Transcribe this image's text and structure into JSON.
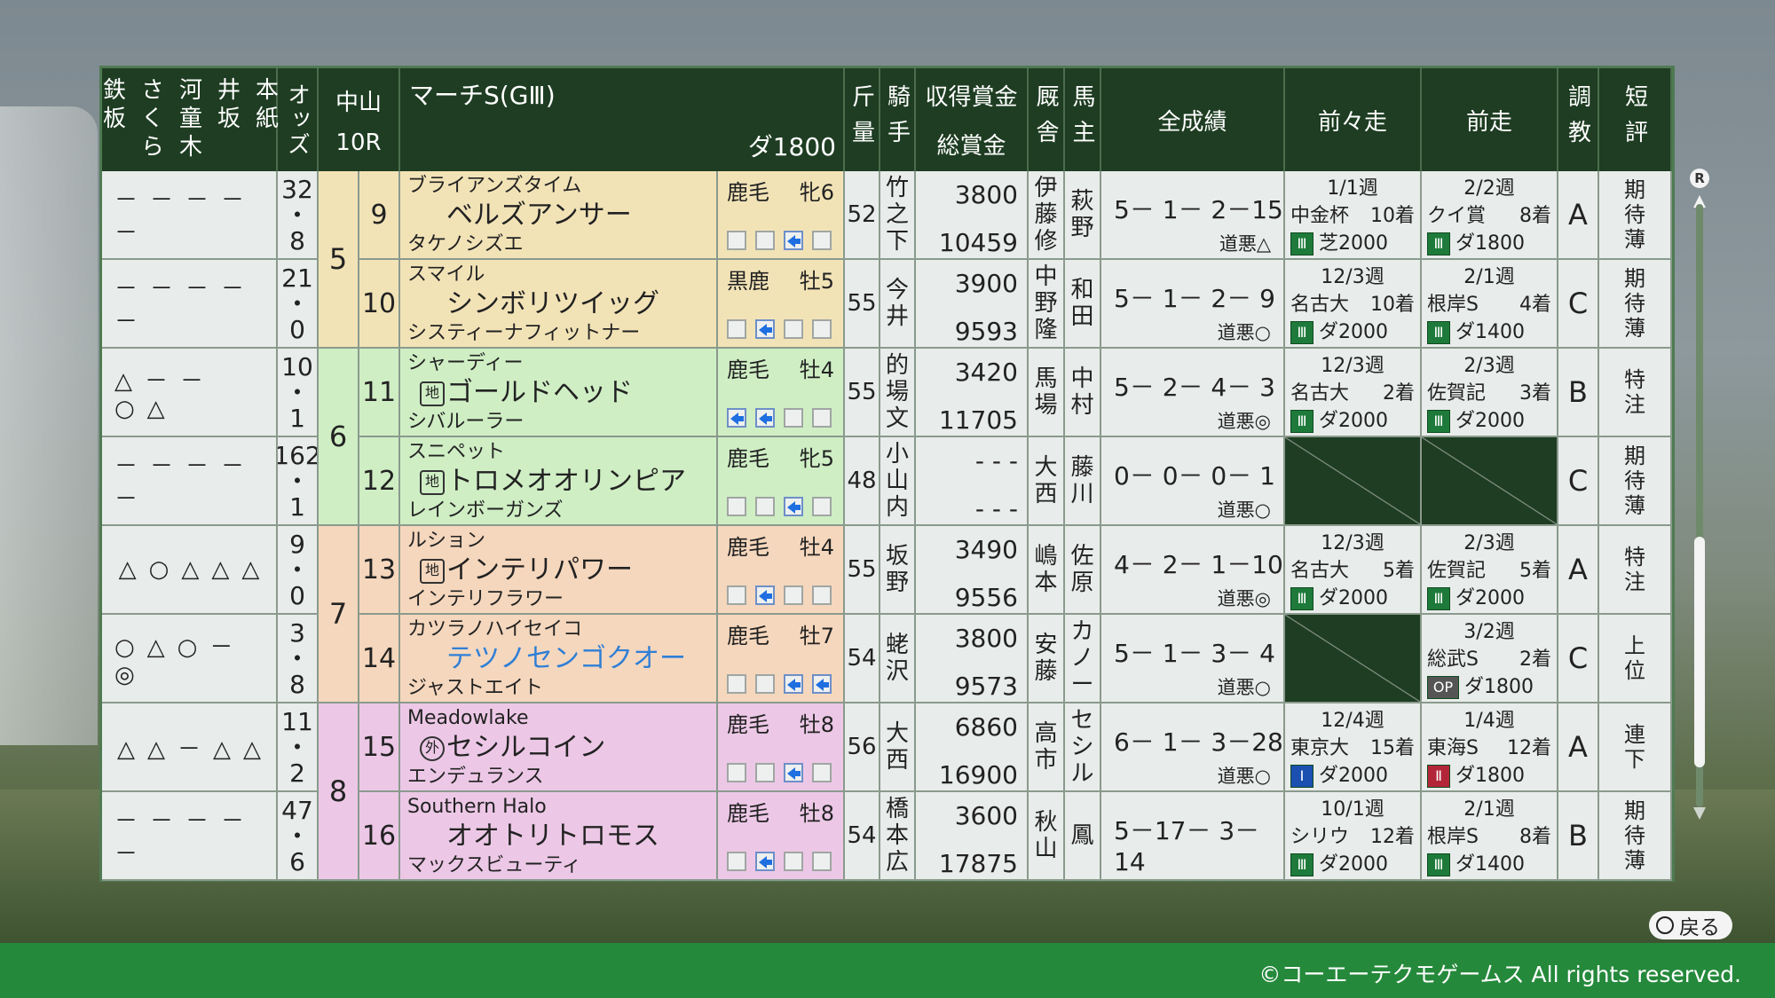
{
  "race": {
    "course": "中山",
    "race_no": "10R",
    "name": "マーチS(GⅢ)",
    "distance": "ダ1800"
  },
  "headers": {
    "marks": [
      "鉄板",
      "さくら",
      "河童木",
      "井坂",
      "本紙"
    ],
    "odds": "オッズ",
    "weight": "斤量",
    "jockey": "騎手",
    "prize": "収得賞金",
    "total_prize": "総賞金",
    "stable": "厩舎",
    "owner": "馬主",
    "record": "全成績",
    "prev2": "前々走",
    "prev1": "前走",
    "training": "調教",
    "short_eval": "短評"
  },
  "frames": [
    {
      "no": "5",
      "color": "#f2e3b7"
    },
    {
      "no": "6",
      "color": "#cfeec4"
    },
    {
      "no": "7",
      "color": "#f5d7bd"
    },
    {
      "no": "8",
      "color": "#ecc8e6"
    }
  ],
  "rows": [
    {
      "marks": "－－－－－",
      "odds": [
        "32",
        "・",
        "8"
      ],
      "num": "9",
      "sire": "ブライアンズタイム",
      "tag": "",
      "name": "ベルズアンサー",
      "dam": "タケノシズエ",
      "coat": "鹿毛",
      "sex_age": "牝6",
      "pos": [
        0,
        0,
        1,
        0
      ],
      "weight": "52",
      "jockey": "竹之下",
      "prize": "3800",
      "total": "10459",
      "stable": "伊藤修",
      "owner": "萩野",
      "record": "5－ 1－ 2－15",
      "track": "道悪△",
      "prev2": {
        "date": "1/1週",
        "race": "中金杯",
        "place": "10着",
        "grade": "Ⅲ",
        "surface": "芝2000"
      },
      "prev1": {
        "date": "2/2週",
        "race": "クイ賞",
        "place": "8着",
        "grade": "Ⅲ",
        "surface": "ダ1800"
      },
      "training": "A",
      "short": "期待薄"
    },
    {
      "marks": "－－－－－",
      "odds": [
        "21",
        "・",
        "0"
      ],
      "num": "10",
      "sire": "スマイル",
      "tag": "",
      "name": "シンボリツイッグ",
      "dam": "システィーナフィットナー",
      "coat": "黒鹿",
      "sex_age": "牡5",
      "pos": [
        0,
        1,
        0,
        0
      ],
      "weight": "55",
      "jockey": "今井",
      "prize": "3900",
      "total": "9593",
      "stable": "中野隆",
      "owner": "和田",
      "record": "5－ 1－ 2－ 9",
      "track": "道悪○",
      "prev2": {
        "date": "12/3週",
        "race": "名古大",
        "place": "10着",
        "grade": "Ⅲ",
        "surface": "ダ2000"
      },
      "prev1": {
        "date": "2/1週",
        "race": "根岸S",
        "place": "4着",
        "grade": "Ⅲ",
        "surface": "ダ1400"
      },
      "training": "C",
      "short": "期待薄"
    },
    {
      "marks": "△－－○△",
      "odds": [
        "10",
        "・",
        "1"
      ],
      "num": "11",
      "sire": "シャーディー",
      "tag": "地",
      "name": "ゴールドヘッド",
      "dam": "シバルーラー",
      "coat": "鹿毛",
      "sex_age": "牡4",
      "pos": [
        1,
        1,
        0,
        0
      ],
      "weight": "55",
      "jockey": "的場文",
      "prize": "3420",
      "total": "11705",
      "stable": "馬場",
      "owner": "中村",
      "record": "5－ 2－ 4－ 3",
      "track": "道悪◎",
      "prev2": {
        "date": "12/3週",
        "race": "名古大",
        "place": "2着",
        "grade": "Ⅲ",
        "surface": "ダ2000"
      },
      "prev1": {
        "date": "2/3週",
        "race": "佐賀記",
        "place": "3着",
        "grade": "Ⅲ",
        "surface": "ダ2000"
      },
      "training": "B",
      "short": "特注"
    },
    {
      "marks": "－－－－－",
      "odds": [
        "162",
        "・",
        "1"
      ],
      "num": "12",
      "sire": "スニペット",
      "tag": "地",
      "name": "トロメオオリンピア",
      "dam": "レインボーガンズ",
      "coat": "鹿毛",
      "sex_age": "牝5",
      "pos": [
        0,
        0,
        1,
        0
      ],
      "weight": "48",
      "jockey": "小山内",
      "prize": "- - -",
      "total": "- - -",
      "stable": "大西",
      "owner": "藤川",
      "record": "0－ 0－ 0－ 1",
      "track": "道悪○",
      "prev2": null,
      "prev1": null,
      "training": "C",
      "short": "期待薄"
    },
    {
      "marks": "△○△△△",
      "odds": [
        "9",
        "・",
        "0"
      ],
      "num": "13",
      "sire": "ルション",
      "tag": "地",
      "name": "インテリパワー",
      "dam": "インテリフラワー",
      "coat": "鹿毛",
      "sex_age": "牡4",
      "pos": [
        0,
        1,
        0,
        0
      ],
      "weight": "55",
      "jockey": "坂野",
      "prize": "3490",
      "total": "9556",
      "stable": "嶋本",
      "owner": "佐原",
      "record": "4－ 2－ 1－10",
      "track": "道悪◎",
      "prev2": {
        "date": "12/3週",
        "race": "名古大",
        "place": "5着",
        "grade": "Ⅲ",
        "surface": "ダ2000"
      },
      "prev1": {
        "date": "2/3週",
        "race": "佐賀記",
        "place": "5着",
        "grade": "Ⅲ",
        "surface": "ダ2000"
      },
      "training": "A",
      "short": "特注"
    },
    {
      "marks": "○△○－◎",
      "odds": [
        "3",
        "・",
        "8"
      ],
      "num": "14",
      "sire": "カツラノハイセイコ",
      "tag": "",
      "name": "テツノセンゴクオー",
      "dam": "ジャストエイト",
      "coat": "鹿毛",
      "sex_age": "牡7",
      "pos": [
        0,
        0,
        1,
        1
      ],
      "weight": "54",
      "jockey": "蛯沢",
      "prize": "3800",
      "total": "9573",
      "stable": "安藤",
      "owner": "カノー",
      "record": "5－ 1－ 3－ 4",
      "track": "道悪○",
      "prev2": null,
      "prev1": {
        "date": "3/2週",
        "race": "総武S",
        "place": "2着",
        "grade": "OP",
        "surface": "ダ1800"
      },
      "training": "C",
      "short": "上位"
    },
    {
      "marks": "△△－△△",
      "odds": [
        "11",
        "・",
        "2"
      ],
      "num": "15",
      "sire": "Meadowlake",
      "tag": "外",
      "name": "セシルコイン",
      "dam": "エンデュランス",
      "coat": "鹿毛",
      "sex_age": "牡8",
      "pos": [
        0,
        0,
        1,
        0
      ],
      "weight": "56",
      "jockey": "大西",
      "prize": "6860",
      "total": "16900",
      "stable": "高市",
      "owner": "セシル",
      "record": "6－ 1－ 3－28",
      "track": "道悪○",
      "prev2": {
        "date": "12/4週",
        "race": "東京大",
        "place": "15着",
        "grade": "Ⅰ",
        "surface": "ダ2000"
      },
      "prev1": {
        "date": "1/4週",
        "race": "東海S",
        "place": "12着",
        "grade": "Ⅱ",
        "surface": "ダ1800"
      },
      "training": "A",
      "short": "連下"
    },
    {
      "marks": "－－－－－",
      "odds": [
        "47",
        "・",
        "6"
      ],
      "num": "16",
      "sire": "Southern Halo",
      "tag": "",
      "name": "オオトリトロモス",
      "dam": "マックスビューティ",
      "coat": "鹿毛",
      "sex_age": "牡8",
      "pos": [
        0,
        1,
        0,
        0
      ],
      "weight": "54",
      "jockey": "橋本広",
      "prize": "3600",
      "total": "17875",
      "stable": "秋山",
      "owner": "鳳",
      "record": "5－17－ 3－14",
      "track": "道悪○",
      "prev2": {
        "date": "10/1週",
        "race": "シリウ",
        "place": "12着",
        "grade": "Ⅲ",
        "surface": "ダ2000"
      },
      "prev1": {
        "date": "2/1週",
        "race": "根岸S",
        "place": "8着",
        "grade": "Ⅲ",
        "surface": "ダ1400"
      },
      "training": "B",
      "short": "期待薄"
    }
  ],
  "ui": {
    "back_label": "戻る",
    "copyright": "©コーエーテクモゲームス All rights reserved."
  }
}
